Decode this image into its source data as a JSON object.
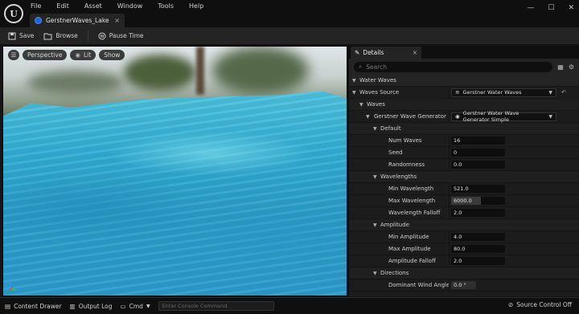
{
  "menu": [
    "File",
    "Edit",
    "Asset",
    "Window",
    "Tools",
    "Help"
  ],
  "tab": {
    "title": "GerstnerWaves_Lake",
    "close": "×"
  },
  "window_controls": [
    "—",
    "☐",
    "✕"
  ],
  "toolbar": {
    "save": "Save",
    "browse": "Browse",
    "pause": "Pause Time"
  },
  "viewport": {
    "menu": "☰",
    "perspective": "Perspective",
    "lit": "Lit",
    "show": "Show"
  },
  "details": {
    "tab_title": "Details",
    "tab_close": "×",
    "search_placeholder": "Search",
    "rows": [
      {
        "label": "Water Waves",
        "value": ""
      },
      {
        "label": "Waves Source",
        "value": "Gerstner Water Waves"
      },
      {
        "label": "Waves",
        "value": ""
      },
      {
        "label": "Gerstner Wave Generator",
        "value": "Gerstner Water Wave Generator Simple"
      },
      {
        "label": "Default",
        "value": ""
      },
      {
        "label": "Num Waves",
        "value": "16"
      },
      {
        "label": "Seed",
        "value": "0"
      },
      {
        "label": "Randomness",
        "value": "0.0"
      },
      {
        "label": "Wavelengths",
        "value": ""
      },
      {
        "label": "Min Wavelength",
        "value": "521.0"
      },
      {
        "label": "Max Wavelength",
        "value": "6000.0"
      },
      {
        "label": "Wavelength Falloff",
        "value": "2.0"
      },
      {
        "label": "Amplitude",
        "value": ""
      },
      {
        "label": "Min Amplitude",
        "value": "4.0"
      },
      {
        "label": "Max Amplitude",
        "value": "80.0"
      },
      {
        "label": "Amplitude Falloff",
        "value": "2.0"
      },
      {
        "label": "Directions",
        "value": ""
      },
      {
        "label": "Dominant Wind Angle",
        "value": "0.0 °"
      }
    ]
  },
  "bottombar": {
    "content_drawer": "Content Drawer",
    "output_log": "Output Log",
    "cmd": "Cmd",
    "console_placeholder": "Enter Console Command",
    "source_control": "Source Control Off"
  },
  "colors": {
    "accent": "#1e63d8",
    "water": "#33aed2",
    "panel": "#1c1c1c"
  }
}
